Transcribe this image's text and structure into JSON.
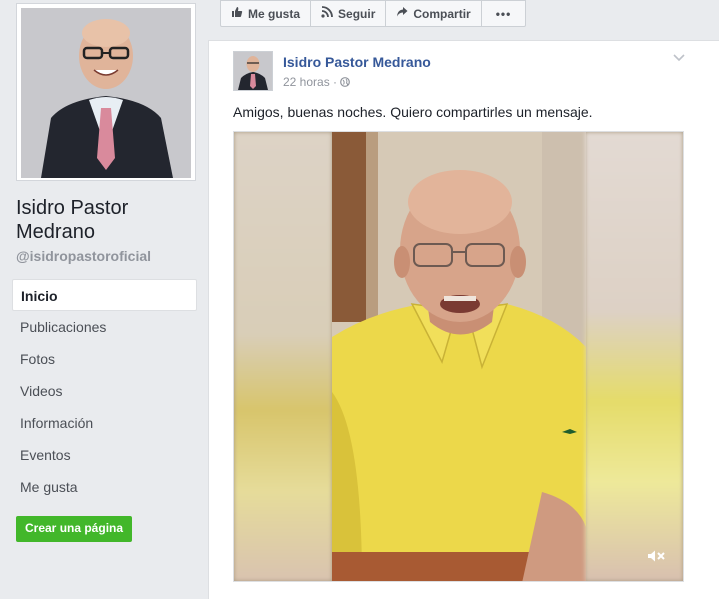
{
  "page": {
    "name": "Isidro Pastor Medrano",
    "handle": "@isidropastoroficial"
  },
  "nav": {
    "items": [
      {
        "label": "Inicio",
        "active": true
      },
      {
        "label": "Publicaciones"
      },
      {
        "label": "Fotos"
      },
      {
        "label": "Videos"
      },
      {
        "label": "Información"
      },
      {
        "label": "Eventos"
      },
      {
        "label": "Me gusta"
      }
    ]
  },
  "create_page": {
    "label": "Crear una página"
  },
  "actions": {
    "like": {
      "label": "Me gusta",
      "icon": "thumbs-up-icon"
    },
    "follow": {
      "label": "Seguir",
      "icon": "rss-icon"
    },
    "share": {
      "label": "Compartir",
      "icon": "share-arrow-icon"
    },
    "more": {
      "label": "•••",
      "icon": "more-icon"
    }
  },
  "post": {
    "author": "Isidro Pastor Medrano",
    "time": "22 horas",
    "separator": "·",
    "audience_icon": "globe-icon",
    "text": "Amigos, buenas noches. Quiero compartirles un mensaje.",
    "video": {
      "muted": true,
      "mute_icon": "muted-speaker-icon"
    }
  },
  "colors": {
    "link": "#365899",
    "create_button": "#42b72a",
    "background": "#e9ebee"
  }
}
